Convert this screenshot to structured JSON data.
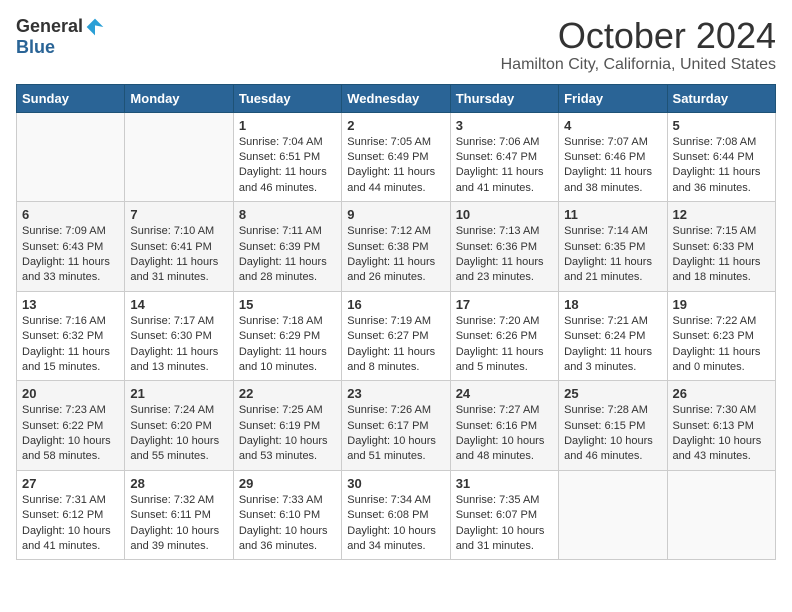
{
  "header": {
    "logo_general": "General",
    "logo_blue": "Blue",
    "month_title": "October 2024",
    "location": "Hamilton City, California, United States"
  },
  "days_of_week": [
    "Sunday",
    "Monday",
    "Tuesday",
    "Wednesday",
    "Thursday",
    "Friday",
    "Saturday"
  ],
  "weeks": [
    [
      {
        "day": "",
        "sunrise": "",
        "sunset": "",
        "daylight": ""
      },
      {
        "day": "",
        "sunrise": "",
        "sunset": "",
        "daylight": ""
      },
      {
        "day": "1",
        "sunrise": "Sunrise: 7:04 AM",
        "sunset": "Sunset: 6:51 PM",
        "daylight": "Daylight: 11 hours and 46 minutes."
      },
      {
        "day": "2",
        "sunrise": "Sunrise: 7:05 AM",
        "sunset": "Sunset: 6:49 PM",
        "daylight": "Daylight: 11 hours and 44 minutes."
      },
      {
        "day": "3",
        "sunrise": "Sunrise: 7:06 AM",
        "sunset": "Sunset: 6:47 PM",
        "daylight": "Daylight: 11 hours and 41 minutes."
      },
      {
        "day": "4",
        "sunrise": "Sunrise: 7:07 AM",
        "sunset": "Sunset: 6:46 PM",
        "daylight": "Daylight: 11 hours and 38 minutes."
      },
      {
        "day": "5",
        "sunrise": "Sunrise: 7:08 AM",
        "sunset": "Sunset: 6:44 PM",
        "daylight": "Daylight: 11 hours and 36 minutes."
      }
    ],
    [
      {
        "day": "6",
        "sunrise": "Sunrise: 7:09 AM",
        "sunset": "Sunset: 6:43 PM",
        "daylight": "Daylight: 11 hours and 33 minutes."
      },
      {
        "day": "7",
        "sunrise": "Sunrise: 7:10 AM",
        "sunset": "Sunset: 6:41 PM",
        "daylight": "Daylight: 11 hours and 31 minutes."
      },
      {
        "day": "8",
        "sunrise": "Sunrise: 7:11 AM",
        "sunset": "Sunset: 6:39 PM",
        "daylight": "Daylight: 11 hours and 28 minutes."
      },
      {
        "day": "9",
        "sunrise": "Sunrise: 7:12 AM",
        "sunset": "Sunset: 6:38 PM",
        "daylight": "Daylight: 11 hours and 26 minutes."
      },
      {
        "day": "10",
        "sunrise": "Sunrise: 7:13 AM",
        "sunset": "Sunset: 6:36 PM",
        "daylight": "Daylight: 11 hours and 23 minutes."
      },
      {
        "day": "11",
        "sunrise": "Sunrise: 7:14 AM",
        "sunset": "Sunset: 6:35 PM",
        "daylight": "Daylight: 11 hours and 21 minutes."
      },
      {
        "day": "12",
        "sunrise": "Sunrise: 7:15 AM",
        "sunset": "Sunset: 6:33 PM",
        "daylight": "Daylight: 11 hours and 18 minutes."
      }
    ],
    [
      {
        "day": "13",
        "sunrise": "Sunrise: 7:16 AM",
        "sunset": "Sunset: 6:32 PM",
        "daylight": "Daylight: 11 hours and 15 minutes."
      },
      {
        "day": "14",
        "sunrise": "Sunrise: 7:17 AM",
        "sunset": "Sunset: 6:30 PM",
        "daylight": "Daylight: 11 hours and 13 minutes."
      },
      {
        "day": "15",
        "sunrise": "Sunrise: 7:18 AM",
        "sunset": "Sunset: 6:29 PM",
        "daylight": "Daylight: 11 hours and 10 minutes."
      },
      {
        "day": "16",
        "sunrise": "Sunrise: 7:19 AM",
        "sunset": "Sunset: 6:27 PM",
        "daylight": "Daylight: 11 hours and 8 minutes."
      },
      {
        "day": "17",
        "sunrise": "Sunrise: 7:20 AM",
        "sunset": "Sunset: 6:26 PM",
        "daylight": "Daylight: 11 hours and 5 minutes."
      },
      {
        "day": "18",
        "sunrise": "Sunrise: 7:21 AM",
        "sunset": "Sunset: 6:24 PM",
        "daylight": "Daylight: 11 hours and 3 minutes."
      },
      {
        "day": "19",
        "sunrise": "Sunrise: 7:22 AM",
        "sunset": "Sunset: 6:23 PM",
        "daylight": "Daylight: 11 hours and 0 minutes."
      }
    ],
    [
      {
        "day": "20",
        "sunrise": "Sunrise: 7:23 AM",
        "sunset": "Sunset: 6:22 PM",
        "daylight": "Daylight: 10 hours and 58 minutes."
      },
      {
        "day": "21",
        "sunrise": "Sunrise: 7:24 AM",
        "sunset": "Sunset: 6:20 PM",
        "daylight": "Daylight: 10 hours and 55 minutes."
      },
      {
        "day": "22",
        "sunrise": "Sunrise: 7:25 AM",
        "sunset": "Sunset: 6:19 PM",
        "daylight": "Daylight: 10 hours and 53 minutes."
      },
      {
        "day": "23",
        "sunrise": "Sunrise: 7:26 AM",
        "sunset": "Sunset: 6:17 PM",
        "daylight": "Daylight: 10 hours and 51 minutes."
      },
      {
        "day": "24",
        "sunrise": "Sunrise: 7:27 AM",
        "sunset": "Sunset: 6:16 PM",
        "daylight": "Daylight: 10 hours and 48 minutes."
      },
      {
        "day": "25",
        "sunrise": "Sunrise: 7:28 AM",
        "sunset": "Sunset: 6:15 PM",
        "daylight": "Daylight: 10 hours and 46 minutes."
      },
      {
        "day": "26",
        "sunrise": "Sunrise: 7:30 AM",
        "sunset": "Sunset: 6:13 PM",
        "daylight": "Daylight: 10 hours and 43 minutes."
      }
    ],
    [
      {
        "day": "27",
        "sunrise": "Sunrise: 7:31 AM",
        "sunset": "Sunset: 6:12 PM",
        "daylight": "Daylight: 10 hours and 41 minutes."
      },
      {
        "day": "28",
        "sunrise": "Sunrise: 7:32 AM",
        "sunset": "Sunset: 6:11 PM",
        "daylight": "Daylight: 10 hours and 39 minutes."
      },
      {
        "day": "29",
        "sunrise": "Sunrise: 7:33 AM",
        "sunset": "Sunset: 6:10 PM",
        "daylight": "Daylight: 10 hours and 36 minutes."
      },
      {
        "day": "30",
        "sunrise": "Sunrise: 7:34 AM",
        "sunset": "Sunset: 6:08 PM",
        "daylight": "Daylight: 10 hours and 34 minutes."
      },
      {
        "day": "31",
        "sunrise": "Sunrise: 7:35 AM",
        "sunset": "Sunset: 6:07 PM",
        "daylight": "Daylight: 10 hours and 31 minutes."
      },
      {
        "day": "",
        "sunrise": "",
        "sunset": "",
        "daylight": ""
      },
      {
        "day": "",
        "sunrise": "",
        "sunset": "",
        "daylight": ""
      }
    ]
  ]
}
